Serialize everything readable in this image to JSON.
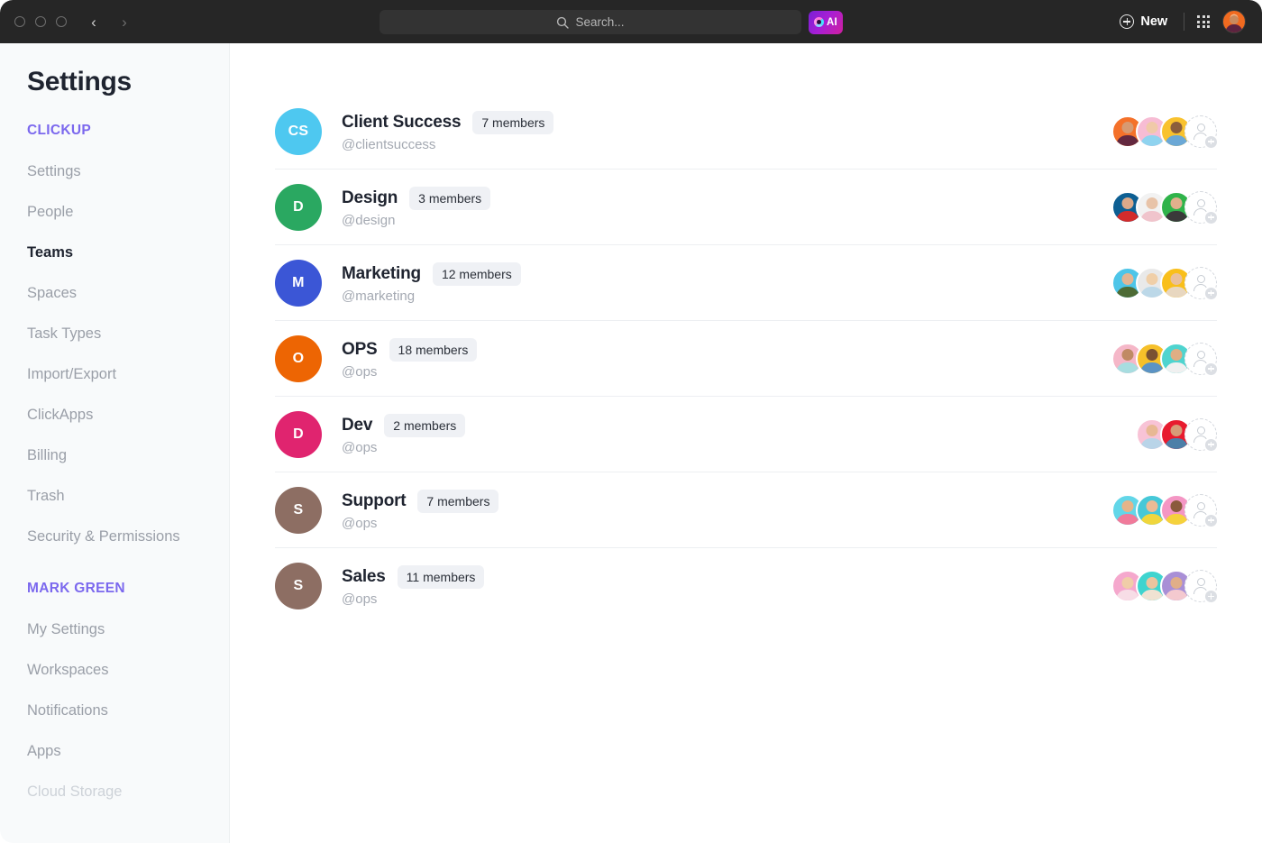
{
  "topbar": {
    "window_dots": [
      "close",
      "minimize",
      "maximize"
    ],
    "back_label": "‹",
    "forward_label": "›",
    "search": {
      "placeholder": "Search...",
      "value": "",
      "icon": "search-icon"
    },
    "ai_button": {
      "label": "AI",
      "icon": "ai-sparkle-icon",
      "gradient_from": "#7a1fd6",
      "gradient_to": "#d01f9e"
    },
    "new_button": {
      "label": "New",
      "icon": "plus-circle-icon"
    },
    "apps_icon": "grid-apps-icon",
    "avatar": "user-avatar"
  },
  "sidebar": {
    "title": "Settings",
    "sections": [
      {
        "header": "CLICKUP",
        "items": [
          {
            "label": "Settings",
            "state": "normal"
          },
          {
            "label": "People",
            "state": "normal"
          },
          {
            "label": "Teams",
            "state": "active"
          },
          {
            "label": "Spaces",
            "state": "normal"
          },
          {
            "label": "Task Types",
            "state": "normal"
          },
          {
            "label": "Import/Export",
            "state": "normal"
          },
          {
            "label": "ClickApps",
            "state": "normal"
          },
          {
            "label": "Billing",
            "state": "normal"
          },
          {
            "label": "Trash",
            "state": "normal"
          },
          {
            "label": "Security & Permissions",
            "state": "normal"
          }
        ]
      },
      {
        "header": "MARK GREEN",
        "items": [
          {
            "label": "My Settings",
            "state": "normal"
          },
          {
            "label": "Workspaces",
            "state": "normal"
          },
          {
            "label": "Notifications",
            "state": "normal"
          },
          {
            "label": "Apps",
            "state": "normal"
          },
          {
            "label": "Cloud Storage",
            "state": "faded"
          }
        ]
      }
    ],
    "accent_color": "#7b68ee"
  },
  "teams": [
    {
      "initials": "CS",
      "avatar_color": "#4ec8f0",
      "name": "Client Success",
      "handle": "@clientsuccess",
      "members_label": "7 members",
      "member_avatars": [
        {
          "bg": "#f4712a",
          "head": "#d79a72",
          "body": "#63283f"
        },
        {
          "bg": "#f7bcd4",
          "head": "#f0c9a8",
          "body": "#8fd3ef"
        },
        {
          "bg": "#f9c22e",
          "head": "#8b5e3c",
          "body": "#6ba8d6"
        }
      ],
      "add_button": "add-member-button"
    },
    {
      "initials": "D",
      "avatar_color": "#2aa861",
      "name": "Design",
      "handle": "@design",
      "members_label": "3 members",
      "member_avatars": [
        {
          "bg": "#0d5f93",
          "head": "#dba98a",
          "body": "#d22c2c"
        },
        {
          "bg": "#f2f2f2",
          "head": "#e8c3a8",
          "body": "#f0c4cc"
        },
        {
          "bg": "#2fb34a",
          "head": "#e0b08c",
          "body": "#3a3a3a"
        }
      ],
      "add_button": "add-member-button"
    },
    {
      "initials": "M",
      "avatar_color": "#3b56d6",
      "name": "Marketing",
      "handle": "@marketing",
      "members_label": "12 members",
      "member_avatars": [
        {
          "bg": "#4ec5e8",
          "head": "#e3b593",
          "body": "#4d6b35"
        },
        {
          "bg": "#e9e9e9",
          "head": "#f0cfa8",
          "body": "#bcd8e8"
        },
        {
          "bg": "#f9bf1b",
          "head": "#eac09b",
          "body": "#e8d7c0"
        }
      ],
      "add_button": "add-member-button"
    },
    {
      "initials": "O",
      "avatar_color": "#ed6503",
      "name": "OPS",
      "handle": "@ops",
      "members_label": "18 members",
      "member_avatars": [
        {
          "bg": "#f5b7c8",
          "head": "#c08a64",
          "body": "#a8dde0"
        },
        {
          "bg": "#f6c02a",
          "head": "#7a5132",
          "body": "#5b93c4"
        },
        {
          "bg": "#4fd4cf",
          "head": "#e0ae84",
          "body": "#f0f0f0"
        }
      ],
      "add_button": "add-member-button"
    },
    {
      "initials": "D",
      "avatar_color": "#e0246f",
      "name": "Dev",
      "handle": "@ops",
      "members_label": "2 members",
      "member_avatars": [
        {
          "bg": "#f8c3d6",
          "head": "#e8b894",
          "body": "#b9d4e8"
        },
        {
          "bg": "#e81b2e",
          "head": "#d79c78",
          "body": "#4c7fa8"
        }
      ],
      "add_button": "add-member-button"
    },
    {
      "initials": "S",
      "avatar_color": "#8d6e63",
      "name": "Support",
      "handle": "@ops",
      "members_label": "7 members",
      "member_avatars": [
        {
          "bg": "#62d6e8",
          "head": "#e5b489",
          "body": "#f07a9a"
        },
        {
          "bg": "#46c8d8",
          "head": "#ecbb95",
          "body": "#f0d63c"
        },
        {
          "bg": "#f496c4",
          "head": "#8a5a3c",
          "body": "#f5d23c"
        }
      ],
      "add_button": "add-member-button"
    },
    {
      "initials": "S",
      "avatar_color": "#8d6e63",
      "name": "Sales",
      "handle": "@ops",
      "members_label": "11 members",
      "member_avatars": [
        {
          "bg": "#f5a8cd",
          "head": "#f0cda8",
          "body": "#f7dde6"
        },
        {
          "bg": "#3fd4cf",
          "head": "#eac49f",
          "body": "#f0e2d2"
        },
        {
          "bg": "#a98fd6",
          "head": "#e0ae88",
          "body": "#f4c9cf"
        }
      ],
      "add_button": "add-member-button"
    }
  ]
}
